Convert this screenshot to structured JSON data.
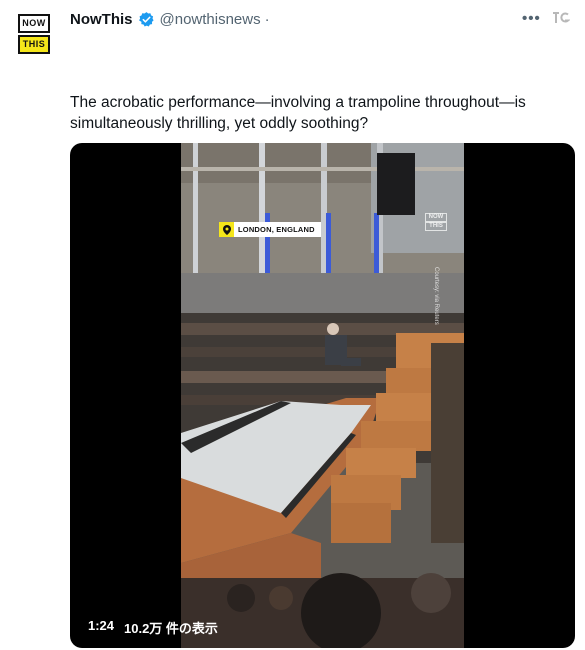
{
  "account": {
    "logo_top": "NOW",
    "logo_bottom": "THIS",
    "name": "NowThis",
    "handle": "@nowthisnews",
    "separator": "·",
    "verified_icon": "verified-badge-icon",
    "verified_color": "#1d9bf0"
  },
  "toolbar": {
    "more_label": "•••",
    "extension_icon": "tg-extension-icon"
  },
  "tweet": {
    "text": "The acrobatic performance—involving a trampoline throughout—is simultaneously thrilling, yet oddly soothing?"
  },
  "video": {
    "duration": "1:24",
    "views": "10.2万 件の表示",
    "location_tag": "LONDON, ENGLAND",
    "watermark_top": "NOW",
    "watermark_bottom": "THIS",
    "credit": "Courtesy: via Reuters",
    "accent_color": "#f5e61a"
  }
}
